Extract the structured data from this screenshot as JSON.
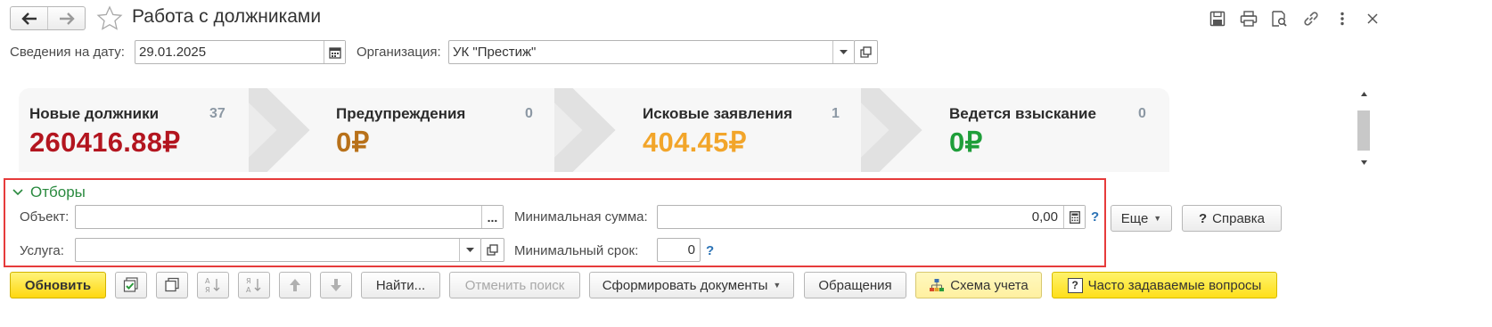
{
  "window": {
    "title": "Работа с должниками"
  },
  "header": {
    "date_label": "Сведения на дату:",
    "date_value": "29.01.2025",
    "org_label": "Организация:",
    "org_value": "УК \"Престиж\""
  },
  "stages": [
    {
      "name": "Новые должники",
      "count": "37",
      "sum": "260416.88₽",
      "color": "#b3151f"
    },
    {
      "name": "Предупреждения",
      "count": "0",
      "sum": "0₽",
      "color": "#b8711a"
    },
    {
      "name": "Исковые заявления",
      "count": "1",
      "sum": "404.45₽",
      "color": "#f2a52a"
    },
    {
      "name": "Ведется взыскание",
      "count": "0",
      "sum": "0₽",
      "color": "#1f9e3a"
    }
  ],
  "filters": {
    "heading": "Отборы",
    "object_label": "Объект:",
    "object_value": "",
    "service_label": "Услуга:",
    "service_value": "",
    "min_sum_label": "Минимальная сумма:",
    "min_sum_value": "0,00",
    "min_term_label": "Минимальный срок:",
    "min_term_value": "0",
    "help_mark": "?"
  },
  "side_buttons": {
    "more": "Еще",
    "help": "Справка",
    "help_mark": "?"
  },
  "toolbar": {
    "refresh": "Обновить",
    "find": "Найти...",
    "cancel_search": "Отменить поиск",
    "generate_docs": "Сформировать документы",
    "appeals": "Обращения",
    "scheme": "Схема учета",
    "faq": "Часто задаваемые вопросы",
    "faq_mark": "?"
  },
  "icons": {
    "back": "arrow-left-icon",
    "forward": "arrow-right-icon",
    "favorite": "star-icon",
    "save": "floppy-icon",
    "print": "printer-icon",
    "preview": "preview-icon",
    "link": "link-icon",
    "more": "kebab-icon",
    "close": "close-icon"
  },
  "colors": {
    "filter_border": "#e63b3b",
    "filter_heading": "#2a8a3f",
    "primary_button": "#ffd80f"
  }
}
